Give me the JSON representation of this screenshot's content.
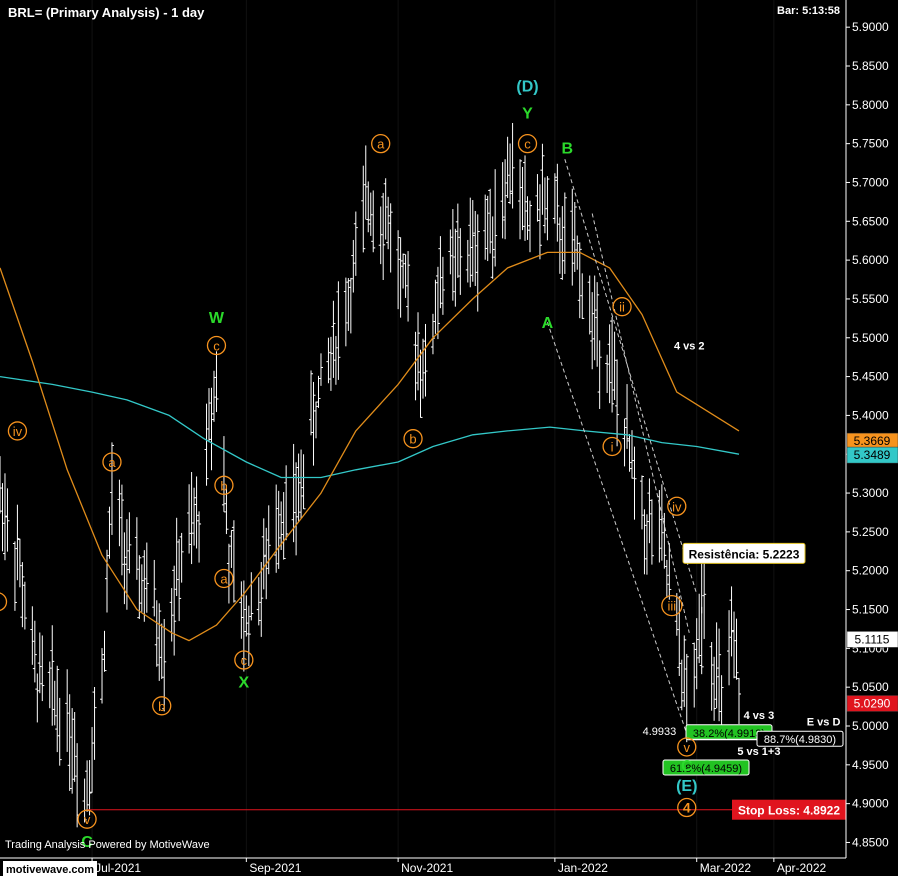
{
  "header": {
    "title": "BRL= (Primary Analysis) - 1 day",
    "bar_time": "Bar: 5:13:58"
  },
  "footer": {
    "powered_by": "Trading Analysis Powered by MotiveWave",
    "watermark": "motivewave.com"
  },
  "colors": {
    "background": "#000000",
    "price_bars": "#ffffff",
    "ma_orange": "#e08c1a",
    "ma_teal": "#33c8c8",
    "wave_orange": "#f7931e",
    "wave_green": "#2bd92b",
    "wave_teal": "#33c8c8",
    "stop_loss": "#e0141e",
    "fib_green": "#22c322"
  },
  "chart_data": {
    "type": "ohlc",
    "symbol": "BRL=",
    "timeframe": "1 day",
    "ylim": [
      4.83,
      5.935
    ],
    "x_range": [
      "2021-05-25",
      "2022-04-30"
    ],
    "y_ticks": [
      "5.9000",
      "5.8500",
      "5.8000",
      "5.7500",
      "5.7000",
      "5.6500",
      "5.6000",
      "5.5500",
      "5.5000",
      "5.4500",
      "5.4000",
      "5.3500",
      "5.3000",
      "5.2500",
      "5.2000",
      "5.1500",
      "5.1000",
      "5.0500",
      "5.0000",
      "4.9500",
      "4.9000",
      "4.8500"
    ],
    "x_ticks": [
      {
        "date": "2021-07-01",
        "label": "Jul-2021"
      },
      {
        "date": "2021-09-01",
        "label": "Sep-2021"
      },
      {
        "date": "2021-11-01",
        "label": "Nov-2021"
      },
      {
        "date": "2022-01-03",
        "label": "Jan-2022"
      },
      {
        "date": "2022-03-01",
        "label": "Mar-2022"
      },
      {
        "date": "2022-04-01",
        "label": "Apr-2022"
      }
    ],
    "price_path": [
      [
        "2021-05-25",
        5.3
      ],
      [
        "2021-06-01",
        5.22
      ],
      [
        "2021-06-08",
        5.07
      ],
      [
        "2021-06-15",
        5.04
      ],
      [
        "2021-06-22",
        5.0
      ],
      [
        "2021-06-28",
        4.91
      ],
      [
        "2021-07-05",
        5.06
      ],
      [
        "2021-07-09",
        5.3
      ],
      [
        "2021-07-16",
        5.2
      ],
      [
        "2021-07-23",
        5.18
      ],
      [
        "2021-07-30",
        5.1
      ],
      [
        "2021-08-06",
        5.22
      ],
      [
        "2021-08-13",
        5.27
      ],
      [
        "2021-08-20",
        5.46
      ],
      [
        "2021-08-25",
        5.22
      ],
      [
        "2021-08-31",
        5.13
      ],
      [
        "2021-09-07",
        5.18
      ],
      [
        "2021-09-14",
        5.28
      ],
      [
        "2021-09-21",
        5.28
      ],
      [
        "2021-09-28",
        5.4
      ],
      [
        "2021-10-05",
        5.48
      ],
      [
        "2021-10-12",
        5.55
      ],
      [
        "2021-10-20",
        5.68
      ],
      [
        "2021-10-28",
        5.65
      ],
      [
        "2021-11-04",
        5.55
      ],
      [
        "2021-11-12",
        5.45
      ],
      [
        "2021-11-18",
        5.58
      ],
      [
        "2021-11-26",
        5.6
      ],
      [
        "2021-12-03",
        5.62
      ],
      [
        "2021-12-10",
        5.66
      ],
      [
        "2021-12-17",
        5.72
      ],
      [
        "2021-12-23",
        5.65
      ],
      [
        "2021-12-30",
        5.68
      ],
      [
        "2022-01-06",
        5.63
      ],
      [
        "2022-01-12",
        5.6
      ],
      [
        "2022-01-18",
        5.52
      ],
      [
        "2022-01-25",
        5.47
      ],
      [
        "2022-02-01",
        5.36
      ],
      [
        "2022-02-08",
        5.26
      ],
      [
        "2022-02-14",
        5.25
      ],
      [
        "2022-02-21",
        5.12
      ],
      [
        "2022-02-25",
        5.03
      ],
      [
        "2022-03-01",
        5.08
      ],
      [
        "2022-03-04",
        5.18
      ],
      [
        "2022-03-08",
        5.07
      ],
      [
        "2022-03-11",
        5.03
      ],
      [
        "2022-03-15",
        5.1
      ],
      [
        "2022-03-18",
        5.05
      ]
    ],
    "ma_orange": [
      [
        "2021-05-25",
        5.59
      ],
      [
        "2021-06-07",
        5.47
      ],
      [
        "2021-06-21",
        5.33
      ],
      [
        "2021-07-05",
        5.22
      ],
      [
        "2021-07-19",
        5.15
      ],
      [
        "2021-08-02",
        5.12
      ],
      [
        "2021-08-09",
        5.11
      ],
      [
        "2021-08-20",
        5.13
      ],
      [
        "2021-08-31",
        5.17
      ],
      [
        "2021-09-14",
        5.23
      ],
      [
        "2021-10-01",
        5.3
      ],
      [
        "2021-10-15",
        5.38
      ],
      [
        "2021-11-01",
        5.44
      ],
      [
        "2021-11-15",
        5.5
      ],
      [
        "2021-12-01",
        5.55
      ],
      [
        "2021-12-15",
        5.59
      ],
      [
        "2021-12-31",
        5.61
      ],
      [
        "2022-01-13",
        5.61
      ],
      [
        "2022-01-25",
        5.59
      ],
      [
        "2022-02-07",
        5.53
      ],
      [
        "2022-02-21",
        5.43
      ],
      [
        "2022-03-18",
        5.38
      ]
    ],
    "ma_teal": [
      [
        "2021-05-25",
        5.45
      ],
      [
        "2021-06-15",
        5.44
      ],
      [
        "2021-07-01",
        5.43
      ],
      [
        "2021-07-15",
        5.42
      ],
      [
        "2021-08-01",
        5.4
      ],
      [
        "2021-08-15",
        5.37
      ],
      [
        "2021-09-01",
        5.34
      ],
      [
        "2021-09-15",
        5.32
      ],
      [
        "2021-10-01",
        5.32
      ],
      [
        "2021-10-15",
        5.33
      ],
      [
        "2021-11-01",
        5.34
      ],
      [
        "2021-11-15",
        5.36
      ],
      [
        "2021-12-01",
        5.375
      ],
      [
        "2021-12-15",
        5.38
      ],
      [
        "2022-01-01",
        5.385
      ],
      [
        "2022-01-15",
        5.38
      ],
      [
        "2022-02-01",
        5.375
      ],
      [
        "2022-02-15",
        5.365
      ],
      [
        "2022-03-01",
        5.36
      ],
      [
        "2022-03-18",
        5.35
      ]
    ],
    "wave_labels": [
      {
        "text": "iv",
        "date": "2021-06-01",
        "price": 5.38,
        "color": "orange",
        "circled": true
      },
      {
        "text": "i",
        "date": "2021-05-24",
        "price": 5.16,
        "color": "orange",
        "circled": true
      },
      {
        "text": "v",
        "date": "2021-06-29",
        "price": 4.88,
        "color": "orange",
        "circled": true
      },
      {
        "text": "C",
        "date": "2021-06-29",
        "price": 4.852,
        "color": "green",
        "circled": false
      },
      {
        "text": "a",
        "date": "2021-07-09",
        "price": 5.34,
        "color": "orange",
        "circled": true
      },
      {
        "text": "b",
        "date": "2021-07-29",
        "price": 5.026,
        "color": "orange",
        "circled": true
      },
      {
        "text": "c",
        "date": "2021-08-20",
        "price": 5.49,
        "color": "orange",
        "circled": true
      },
      {
        "text": "W",
        "date": "2021-08-20",
        "price": 5.527,
        "color": "green",
        "circled": false
      },
      {
        "text": "b",
        "date": "2021-08-23",
        "price": 5.31,
        "color": "orange",
        "circled": true
      },
      {
        "text": "a",
        "date": "2021-08-23",
        "price": 5.19,
        "color": "orange",
        "circled": true
      },
      {
        "text": "c",
        "date": "2021-08-31",
        "price": 5.085,
        "color": "orange",
        "circled": true
      },
      {
        "text": "X",
        "date": "2021-08-31",
        "price": 5.057,
        "color": "green",
        "circled": false
      },
      {
        "text": "a",
        "date": "2021-10-25",
        "price": 5.75,
        "color": "orange",
        "circled": true
      },
      {
        "text": "b",
        "date": "2021-11-07",
        "price": 5.37,
        "color": "orange",
        "circled": true
      },
      {
        "text": "c",
        "date": "2021-12-23",
        "price": 5.75,
        "color": "orange",
        "circled": true
      },
      {
        "text": "Y",
        "date": "2021-12-23",
        "price": 5.79,
        "color": "green",
        "circled": false
      },
      {
        "text": "(D)",
        "date": "2021-12-23",
        "price": 5.825,
        "color": "teal",
        "circled": false
      },
      {
        "text": "A",
        "date": "2021-12-31",
        "price": 5.52,
        "color": "green",
        "circled": false
      },
      {
        "text": "B",
        "date": "2022-01-08",
        "price": 5.745,
        "color": "green",
        "circled": false
      },
      {
        "text": "ii",
        "date": "2022-01-30",
        "price": 5.54,
        "color": "orange",
        "circled": true
      },
      {
        "text": "i",
        "date": "2022-01-26",
        "price": 5.36,
        "color": "orange",
        "circled": true
      },
      {
        "text": "iv",
        "date": "2022-02-21",
        "price": 5.283,
        "color": "orange",
        "circled": true
      },
      {
        "text": "iii",
        "date": "2022-02-19",
        "price": 5.155,
        "color": "orange",
        "circled": true
      },
      {
        "text": "v",
        "date": "2022-02-25",
        "price": 4.973,
        "color": "orange",
        "circled": true
      },
      {
        "text": "C",
        "date": "2022-02-25",
        "price": 4.95,
        "color": "green",
        "circled": false
      },
      {
        "text": "(E)",
        "date": "2022-02-25",
        "price": 4.924,
        "color": "teal",
        "circled": false
      },
      {
        "text": "4",
        "date": "2022-02-25",
        "price": 4.895,
        "color": "orange",
        "circled": true
      }
    ],
    "text_annotations": [
      {
        "text": "4 vs 2",
        "date": "2022-02-26",
        "price": 5.49
      },
      {
        "text": "4 vs 3",
        "date": "2022-03-26",
        "price": 5.014
      },
      {
        "text": "E vs D",
        "date": "2022-04-21",
        "price": 5.006
      },
      {
        "text": "5 vs 1+3",
        "date": "2022-03-26",
        "price": 4.968
      }
    ],
    "price_labels": [
      {
        "text": "5.3669",
        "price": 5.3669,
        "bg": "#f7931e",
        "fg": "#000000"
      },
      {
        "text": "5.3489",
        "price": 5.3489,
        "bg": "#33c8c8",
        "fg": "#000000"
      },
      {
        "text": "5.1115",
        "price": 5.1115,
        "bg": "#ffffff",
        "fg": "#000000"
      },
      {
        "text": "5.0290",
        "price": 5.029,
        "bg": "#e0141e",
        "fg": "#ffffff"
      }
    ],
    "resistance": {
      "label": "Resistência: 5.2223",
      "price": 5.2223,
      "from_date": "2022-03-03"
    },
    "stop_loss": {
      "label": "Stop Loss: 4.8922",
      "price": 4.8922,
      "from_date": "2021-06-29"
    },
    "low_marker": {
      "text": "4.9933",
      "price": 4.9933,
      "date": "2022-02-24"
    },
    "fib_boxes": [
      {
        "text": "38.2%(4.9913)",
        "price": 4.9913,
        "style": "green",
        "from_date": "2022-02-26"
      },
      {
        "text": "88.7%(4.9830)",
        "price": 4.983,
        "style": "white",
        "from_date": "2022-02-26"
      },
      {
        "text": "61.8%(4.9459)",
        "price": 4.9459,
        "style": "green",
        "from_date": "2022-03-05"
      }
    ]
  }
}
